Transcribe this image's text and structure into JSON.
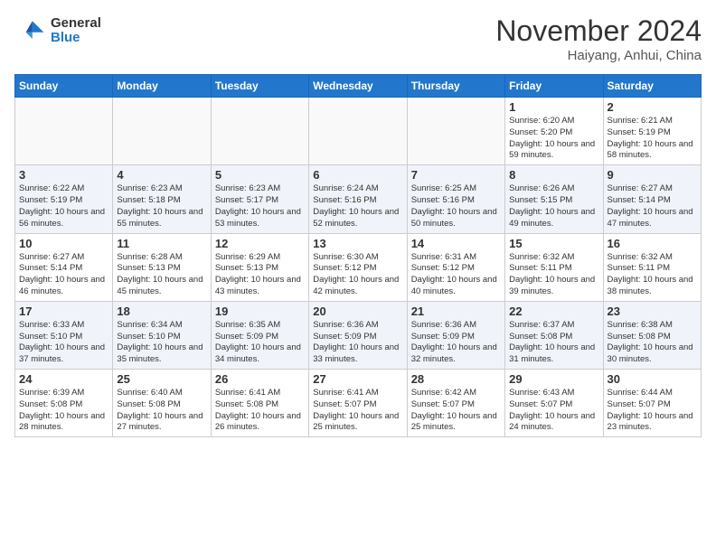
{
  "header": {
    "logo_general": "General",
    "logo_blue": "Blue",
    "month_title": "November 2024",
    "location": "Haiyang, Anhui, China"
  },
  "days_of_week": [
    "Sunday",
    "Monday",
    "Tuesday",
    "Wednesday",
    "Thursday",
    "Friday",
    "Saturday"
  ],
  "weeks": [
    [
      {
        "day": "",
        "info": ""
      },
      {
        "day": "",
        "info": ""
      },
      {
        "day": "",
        "info": ""
      },
      {
        "day": "",
        "info": ""
      },
      {
        "day": "",
        "info": ""
      },
      {
        "day": "1",
        "info": "Sunrise: 6:20 AM\nSunset: 5:20 PM\nDaylight: 10 hours and 59 minutes."
      },
      {
        "day": "2",
        "info": "Sunrise: 6:21 AM\nSunset: 5:19 PM\nDaylight: 10 hours and 58 minutes."
      }
    ],
    [
      {
        "day": "3",
        "info": "Sunrise: 6:22 AM\nSunset: 5:19 PM\nDaylight: 10 hours and 56 minutes."
      },
      {
        "day": "4",
        "info": "Sunrise: 6:23 AM\nSunset: 5:18 PM\nDaylight: 10 hours and 55 minutes."
      },
      {
        "day": "5",
        "info": "Sunrise: 6:23 AM\nSunset: 5:17 PM\nDaylight: 10 hours and 53 minutes."
      },
      {
        "day": "6",
        "info": "Sunrise: 6:24 AM\nSunset: 5:16 PM\nDaylight: 10 hours and 52 minutes."
      },
      {
        "day": "7",
        "info": "Sunrise: 6:25 AM\nSunset: 5:16 PM\nDaylight: 10 hours and 50 minutes."
      },
      {
        "day": "8",
        "info": "Sunrise: 6:26 AM\nSunset: 5:15 PM\nDaylight: 10 hours and 49 minutes."
      },
      {
        "day": "9",
        "info": "Sunrise: 6:27 AM\nSunset: 5:14 PM\nDaylight: 10 hours and 47 minutes."
      }
    ],
    [
      {
        "day": "10",
        "info": "Sunrise: 6:27 AM\nSunset: 5:14 PM\nDaylight: 10 hours and 46 minutes."
      },
      {
        "day": "11",
        "info": "Sunrise: 6:28 AM\nSunset: 5:13 PM\nDaylight: 10 hours and 45 minutes."
      },
      {
        "day": "12",
        "info": "Sunrise: 6:29 AM\nSunset: 5:13 PM\nDaylight: 10 hours and 43 minutes."
      },
      {
        "day": "13",
        "info": "Sunrise: 6:30 AM\nSunset: 5:12 PM\nDaylight: 10 hours and 42 minutes."
      },
      {
        "day": "14",
        "info": "Sunrise: 6:31 AM\nSunset: 5:12 PM\nDaylight: 10 hours and 40 minutes."
      },
      {
        "day": "15",
        "info": "Sunrise: 6:32 AM\nSunset: 5:11 PM\nDaylight: 10 hours and 39 minutes."
      },
      {
        "day": "16",
        "info": "Sunrise: 6:32 AM\nSunset: 5:11 PM\nDaylight: 10 hours and 38 minutes."
      }
    ],
    [
      {
        "day": "17",
        "info": "Sunrise: 6:33 AM\nSunset: 5:10 PM\nDaylight: 10 hours and 37 minutes."
      },
      {
        "day": "18",
        "info": "Sunrise: 6:34 AM\nSunset: 5:10 PM\nDaylight: 10 hours and 35 minutes."
      },
      {
        "day": "19",
        "info": "Sunrise: 6:35 AM\nSunset: 5:09 PM\nDaylight: 10 hours and 34 minutes."
      },
      {
        "day": "20",
        "info": "Sunrise: 6:36 AM\nSunset: 5:09 PM\nDaylight: 10 hours and 33 minutes."
      },
      {
        "day": "21",
        "info": "Sunrise: 6:36 AM\nSunset: 5:09 PM\nDaylight: 10 hours and 32 minutes."
      },
      {
        "day": "22",
        "info": "Sunrise: 6:37 AM\nSunset: 5:08 PM\nDaylight: 10 hours and 31 minutes."
      },
      {
        "day": "23",
        "info": "Sunrise: 6:38 AM\nSunset: 5:08 PM\nDaylight: 10 hours and 30 minutes."
      }
    ],
    [
      {
        "day": "24",
        "info": "Sunrise: 6:39 AM\nSunset: 5:08 PM\nDaylight: 10 hours and 28 minutes."
      },
      {
        "day": "25",
        "info": "Sunrise: 6:40 AM\nSunset: 5:08 PM\nDaylight: 10 hours and 27 minutes."
      },
      {
        "day": "26",
        "info": "Sunrise: 6:41 AM\nSunset: 5:08 PM\nDaylight: 10 hours and 26 minutes."
      },
      {
        "day": "27",
        "info": "Sunrise: 6:41 AM\nSunset: 5:07 PM\nDaylight: 10 hours and 25 minutes."
      },
      {
        "day": "28",
        "info": "Sunrise: 6:42 AM\nSunset: 5:07 PM\nDaylight: 10 hours and 25 minutes."
      },
      {
        "day": "29",
        "info": "Sunrise: 6:43 AM\nSunset: 5:07 PM\nDaylight: 10 hours and 24 minutes."
      },
      {
        "day": "30",
        "info": "Sunrise: 6:44 AM\nSunset: 5:07 PM\nDaylight: 10 hours and 23 minutes."
      }
    ]
  ]
}
